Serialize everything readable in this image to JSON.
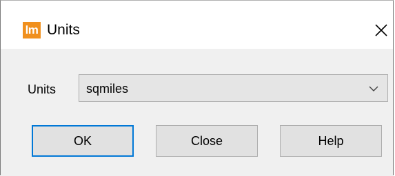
{
  "window": {
    "app_icon_text": "lm",
    "title": "Units",
    "close_icon": "close-icon"
  },
  "form": {
    "units_label": "Units",
    "units_value": "sqmiles"
  },
  "buttons": {
    "ok": "OK",
    "close": "Close",
    "help": "Help"
  },
  "colors": {
    "app_icon_bg": "#f0901e",
    "focus_border": "#0078d7"
  }
}
